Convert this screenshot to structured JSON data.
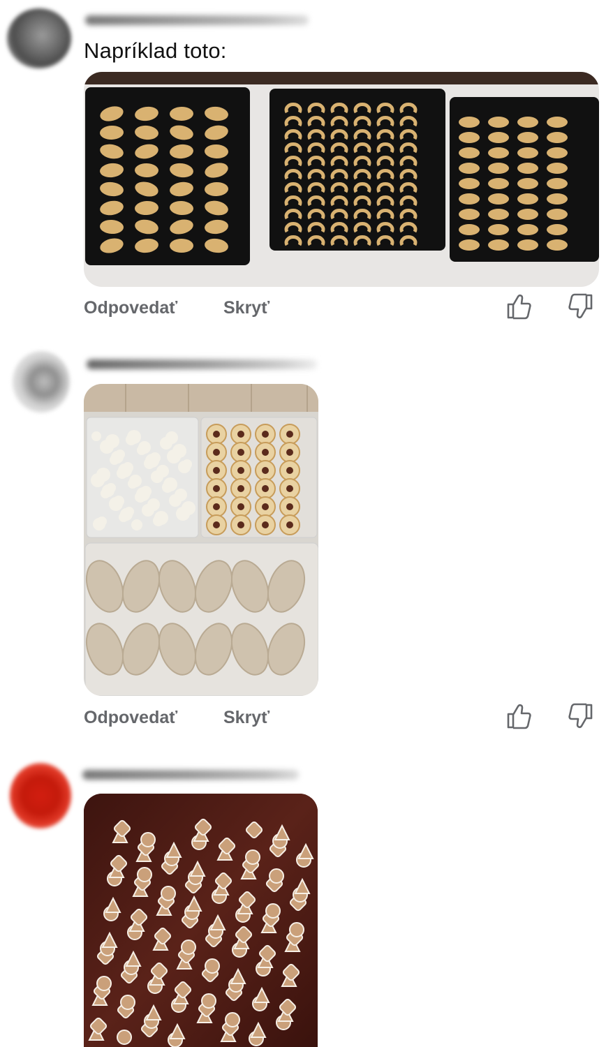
{
  "comments": [
    {
      "author_visible": false,
      "text": "Napríklad toto:",
      "photo_icon": "cookie-trays-photo",
      "actions": {
        "reply_label": "Odpovedať",
        "hide_label": "Skryť"
      },
      "icons": [
        "thumbs-up-icon",
        "thumbs-down-icon"
      ]
    },
    {
      "author_visible": false,
      "text": "",
      "photo_icon": "cookie-boxes-photo",
      "actions": {
        "reply_label": "Odpovedať",
        "hide_label": "Skryť"
      },
      "icons": [
        "thumbs-up-icon",
        "thumbs-down-icon"
      ]
    },
    {
      "author_visible": false,
      "text": "",
      "photo_icon": "gingerbread-photo"
    }
  ],
  "colors": {
    "action_text": "#65676b",
    "icon_stroke": "#65676b",
    "background": "#ffffff"
  }
}
